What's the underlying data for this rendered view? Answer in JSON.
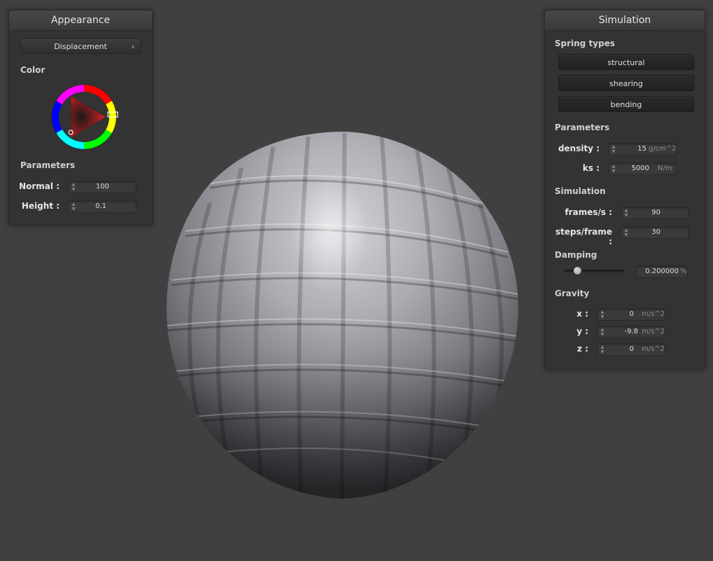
{
  "appearance": {
    "title": "Appearance",
    "shader_dropdown": "Displacement",
    "color_label": "Color",
    "parameters_label": "Parameters",
    "normal_label": "Normal :",
    "normal_value": "100",
    "height_label": "Height :",
    "height_value": "0.1",
    "picked_color": "#e02020"
  },
  "simulation": {
    "title": "Simulation",
    "spring_types_label": "Spring types",
    "spring_buttons": [
      "structural",
      "shearing",
      "bending"
    ],
    "parameters_label": "Parameters",
    "density_label": "density :",
    "density_value": "15",
    "density_unit": "g/cm^2",
    "ks_label": "ks :",
    "ks_value": "5000",
    "ks_unit": "N/m",
    "sim_label": "Simulation",
    "fps_label": "frames/s :",
    "fps_value": "90",
    "steps_label": "steps/frame :",
    "steps_value": "30",
    "damping_label": "Damping",
    "damping_value": "0.200000",
    "damping_unit": "%",
    "damping_fraction": 0.2,
    "gravity_label": "Gravity",
    "gx_label": "x :",
    "gx_value": "0",
    "gy_label": "y :",
    "gy_value": "-9.8",
    "gz_label": "z :",
    "gz_value": "0",
    "gravity_unit": "m/s^2"
  },
  "colors": {
    "background": "#404040",
    "panel": "#333333",
    "mesh": "#a9a6ad"
  }
}
